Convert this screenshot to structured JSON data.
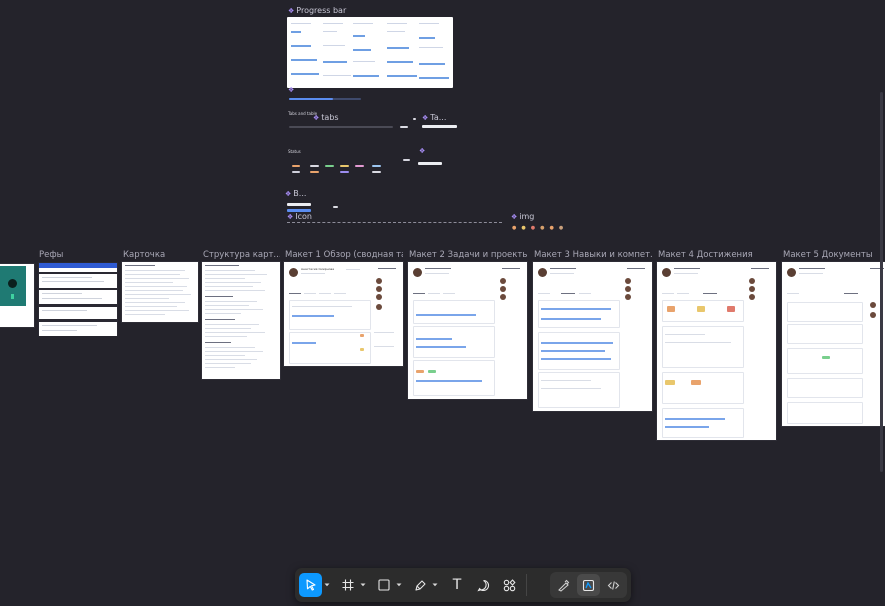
{
  "components": {
    "progress_bar": "Progress bar",
    "tabs": "tabs",
    "tabs_section_label": "Tabs and table",
    "table": "Ta...",
    "status": "Status",
    "icon": "Icon",
    "button": "B...",
    "img": "img"
  },
  "frames": [
    {
      "title": "Рефы"
    },
    {
      "title": "Карточка"
    },
    {
      "title": "Структура карт..."
    },
    {
      "title": "Макет 1 Обзор (сводная та..."
    },
    {
      "title": "Макет 2 Задачи и проекты"
    },
    {
      "title": "Макет 3 Навыки и компет..."
    },
    {
      "title": "Макет 4 Достижения"
    },
    {
      "title": "Макет 5 Документы"
    }
  ],
  "profile": {
    "name": "Анастасия Смирнова"
  },
  "toolbar": {
    "tools": [
      {
        "name": "move",
        "icon": "cursor-icon",
        "active": true
      },
      {
        "name": "frame",
        "icon": "frame-icon"
      },
      {
        "name": "shape",
        "icon": "rectangle-icon"
      },
      {
        "name": "pen",
        "icon": "pen-icon"
      },
      {
        "name": "text",
        "icon": "text-icon",
        "glyph": "T"
      },
      {
        "name": "comment",
        "icon": "comment-icon"
      },
      {
        "name": "actions",
        "icon": "actions-icon"
      }
    ],
    "modes": [
      {
        "name": "draw",
        "icon": "draw-mode-icon"
      },
      {
        "name": "design",
        "icon": "design-mode-icon",
        "active": true
      },
      {
        "name": "dev",
        "icon": "dev-mode-icon"
      }
    ],
    "accent": "#0d99ff"
  },
  "colors": {
    "canvas": "#24232b",
    "component_accent": "#a88ef6"
  }
}
